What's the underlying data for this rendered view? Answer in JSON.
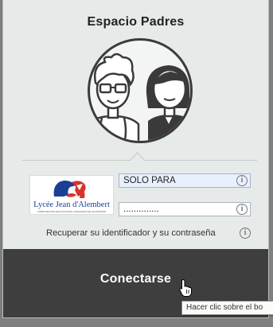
{
  "header": {
    "title": "Espacio Padres"
  },
  "illustration": {
    "icon": "parents-avatar-icon"
  },
  "school": {
    "logo_name": "Lycée Jean d'Alembert",
    "logo_tagline": "CORPORACIÓN EDUCACIONAL FRANCESA DE VALPARAÍSO"
  },
  "login": {
    "username_value": "SOLO PARA",
    "password_value": "..............",
    "info_icon_glyph": "i",
    "recover_link": "Recuperar su identificador y su contraseña",
    "connect_label": "Conectarse"
  },
  "tooltip": {
    "text": "Hacer clic sobre el bo"
  },
  "colors": {
    "button_bg": "#3e3e3e",
    "panel_bg": "#e6eae8",
    "logo_blue": "#1b3f93",
    "logo_red": "#d8322a"
  }
}
